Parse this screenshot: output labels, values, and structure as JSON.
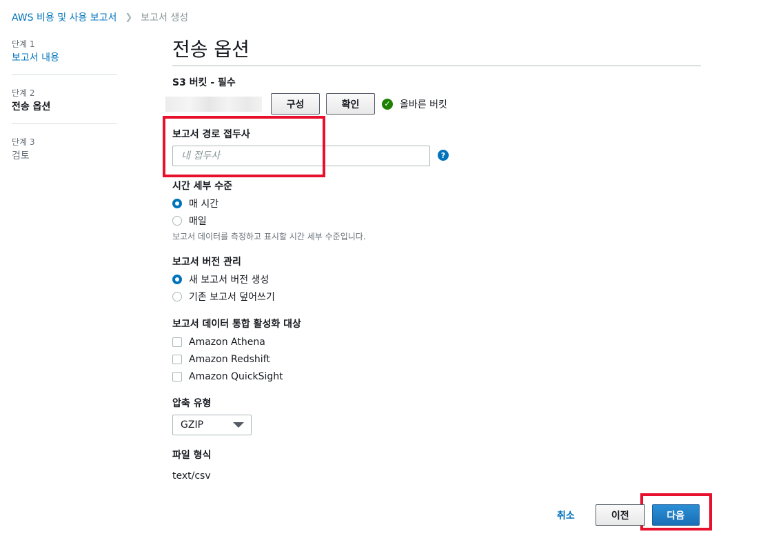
{
  "breadcrumb": {
    "root": "AWS 비용 및 사용 보고서",
    "current": "보고서 생성"
  },
  "steps": [
    {
      "num": "단계 1",
      "name": "보고서 내용"
    },
    {
      "num": "단계 2",
      "name": "전송 옵션"
    },
    {
      "num": "단계 3",
      "name": "검토"
    }
  ],
  "page": {
    "title": "전송 옵션"
  },
  "s3": {
    "label": "S3 버킷 - 필수",
    "configure_label": "구성",
    "verify_label": "확인",
    "valid_text": "올바른 버킷"
  },
  "prefix": {
    "label": "보고서 경로 접두사",
    "placeholder": "내 접두사"
  },
  "granularity": {
    "label": "시간 세부 수준",
    "options": [
      "매 시간",
      "매일"
    ],
    "hint": "보고서 데이터를 측정하고 표시할 시간 세부 수준입니다."
  },
  "versioning": {
    "label": "보고서 버전 관리",
    "options": [
      "새 보고서 버전 생성",
      "기존 보고서 덮어쓰기"
    ]
  },
  "integration": {
    "label": "보고서 데이터 통합 활성화 대상",
    "options": [
      "Amazon Athena",
      "Amazon Redshift",
      "Amazon QuickSight"
    ]
  },
  "compression": {
    "label": "압축 유형",
    "value": "GZIP"
  },
  "file_format": {
    "label": "파일 형식",
    "value": "text/csv"
  },
  "footer": {
    "cancel": "취소",
    "previous": "이전",
    "next": "다음"
  }
}
